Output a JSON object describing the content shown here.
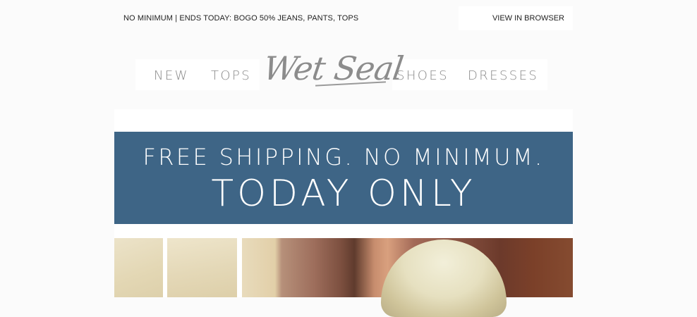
{
  "preheader": {
    "promo_text": "NO MINIMUM | ENDS TODAY: BOGO 50% JEANS, PANTS, TOPS",
    "view_in_browser": "VIEW IN BROWSER"
  },
  "nav": {
    "items": [
      {
        "label": "NEW"
      },
      {
        "label": "TOPS"
      },
      {
        "label": "SHOES"
      },
      {
        "label": "DRESSES"
      }
    ],
    "logo_text": "Wet Seal"
  },
  "banner": {
    "line1": "FREE SHIPPING. NO MINIMUM.",
    "line2": "TODAY ONLY",
    "background_color": "#3e6586"
  },
  "hero_images": [
    {
      "name": "photo-left-panel"
    },
    {
      "name": "photo-middle-panel"
    },
    {
      "name": "photo-model-blonde"
    }
  ]
}
